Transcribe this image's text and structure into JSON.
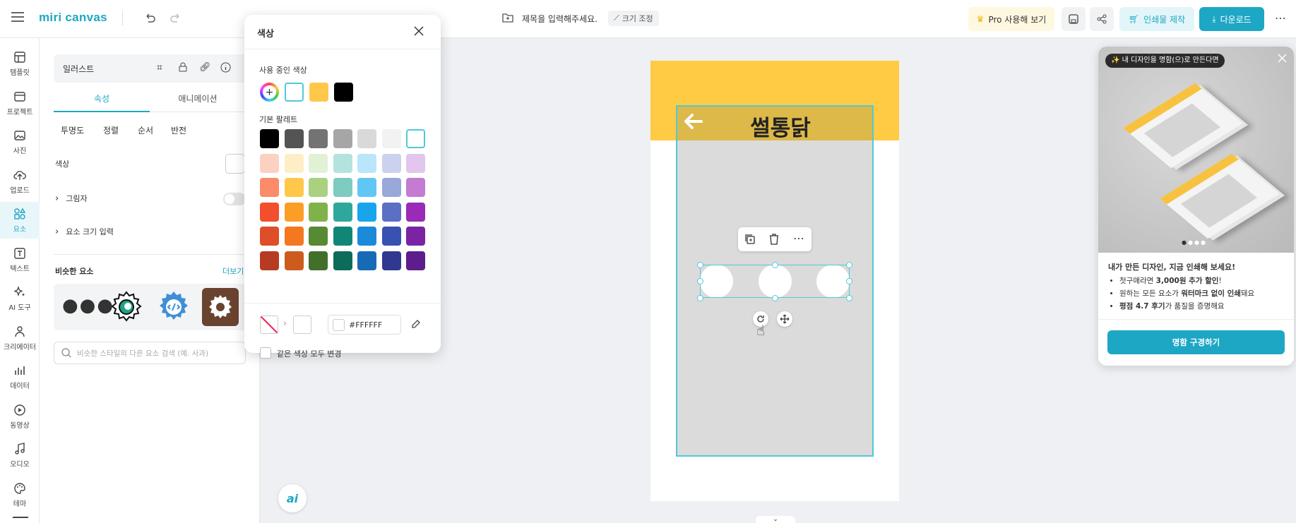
{
  "topbar": {
    "logo": "miri canvas",
    "title_placeholder": "제목을 입력해주세요.",
    "resize_label": "크기 조정",
    "pro_label": "Pro 사용해 보기",
    "print_label": "인쇄물 제작",
    "download_label": "다운로드"
  },
  "rail": {
    "items": [
      {
        "label": "템플릿",
        "icon": "template-icon"
      },
      {
        "label": "프로젝트",
        "icon": "project-icon"
      },
      {
        "label": "사진",
        "icon": "photo-icon"
      },
      {
        "label": "업로드",
        "icon": "upload-icon"
      },
      {
        "label": "요소",
        "icon": "elements-icon"
      },
      {
        "label": "텍스트",
        "icon": "text-icon"
      },
      {
        "label": "AI 도구",
        "icon": "ai-tools-icon"
      },
      {
        "label": "크리에이터",
        "icon": "creator-icon"
      },
      {
        "label": "데이터",
        "icon": "data-icon"
      },
      {
        "label": "동영상",
        "icon": "video-icon"
      },
      {
        "label": "오디오",
        "icon": "audio-icon"
      },
      {
        "label": "테마",
        "icon": "theme-icon"
      }
    ]
  },
  "panel": {
    "element_type": "일러스트",
    "tabs": [
      "속성",
      "애니메이션"
    ],
    "subtabs": [
      "투명도",
      "정렬",
      "순서",
      "반전"
    ],
    "color_label": "색상",
    "shadow_label": "그림자",
    "size_input_label": "요소 크기 입력",
    "similar_title": "비슷한 요소",
    "more_label": "더보기",
    "search_placeholder": "비슷한 스타일의 다른 요소 검색 (예. 사과)"
  },
  "color_popup": {
    "title": "색상",
    "used_colors_label": "사용 중인 색상",
    "used_colors": [
      "#FFFFFF",
      "#FFC84A",
      "#000000"
    ],
    "palette_label": "기본 팔레트",
    "palette": [
      [
        "#000000",
        "#545454",
        "#737373",
        "#a6a6a6",
        "#d9d9d9",
        "#f2f2f2",
        "#ffffff"
      ],
      [
        "#fcd1c2",
        "#fdeec6",
        "#e1f1d5",
        "#b3e3dd",
        "#b9e6fa",
        "#ccd1ef",
        "#e2c6ee"
      ],
      [
        "#fa8b6b",
        "#ffc84a",
        "#a9d17f",
        "#7ecbc0",
        "#62c6f5",
        "#9aa7d9",
        "#c47bd2"
      ],
      [
        "#f14f2e",
        "#fb9e25",
        "#7fb24a",
        "#2ea89a",
        "#19a5ec",
        "#5b6fc4",
        "#9a2ab8"
      ],
      [
        "#de4e28",
        "#f5771f",
        "#578a33",
        "#128676",
        "#1b8ad8",
        "#3951b0",
        "#7a23a5"
      ],
      [
        "#b73b22",
        "#cc5c1d",
        "#42702a",
        "#0c6b5b",
        "#176ab5",
        "#30398f",
        "#5e1d8c"
      ]
    ],
    "hex_value": "#FFFFFF",
    "same_color_label": "같은 색상 모두 변경"
  },
  "canvas": {
    "header_title": "썰통닭",
    "accent_color": "#FFCB45"
  },
  "promo": {
    "badge": "✨ 내 디자인을 명함(으)로 만든다면",
    "headline": "내가 만든 디자인, 지금 인쇄해 보세요!",
    "bullets": [
      {
        "pre": "첫구매라면 ",
        "bold": "3,000원 추가 할인",
        "post": "!"
      },
      {
        "pre": "원하는 모든 요소가 ",
        "bold": "워터마크 없이 인쇄",
        "post": "돼요"
      },
      {
        "pre": "",
        "bold": "평점 4.7 후기",
        "post": "가 품질을 증명해요"
      }
    ],
    "cta": "명함 구경하기",
    "card_label": "명함 카드"
  },
  "colors": {
    "accent": "#1ea7c4",
    "selection": "#4fc9da",
    "pro_bg": "#fff8e1"
  }
}
